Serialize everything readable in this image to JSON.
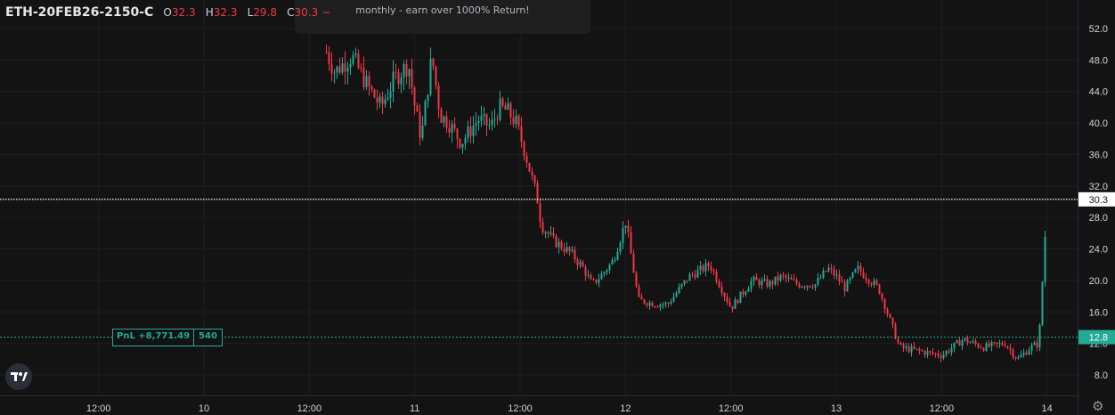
{
  "header": {
    "symbol": "ETH-20FEB26-2150-C",
    "open_label": "O",
    "open": "32.3",
    "high_label": "H",
    "high": "32.3",
    "low_label": "L",
    "low": "29.8",
    "close_label": "C",
    "close": "30.3",
    "change": "−"
  },
  "banner": {
    "text": "monthly - earn over 1000% Return!"
  },
  "pnl": {
    "label": "PnL +8,771.49",
    "qty": "540"
  },
  "y_ticks": [
    "52.0",
    "48.0",
    "44.0",
    "40.0",
    "36.0",
    "32.0",
    "28.0",
    "24.0",
    "20.0",
    "16.0",
    "12.0",
    "8.0"
  ],
  "x_ticks": [
    "12:00",
    "10",
    "12:00",
    "11",
    "12:00",
    "12",
    "12:00",
    "13",
    "12:00",
    "14"
  ],
  "last_price_tag": "30.3",
  "position_price_tag": "12.8",
  "icons": {
    "logo": "tradingview-logo-icon",
    "settings": "gear-icon"
  },
  "colors": {
    "up": "#22ab94",
    "down": "#f23645",
    "background": "#131313",
    "text": "#d1d4dc"
  },
  "chart_data": {
    "type": "candlestick",
    "y_range": [
      6.0,
      54.0
    ],
    "last_price": 30.3,
    "position_price": 12.8,
    "path_x_day": [
      10.58,
      10.62,
      10.7,
      10.78,
      10.84,
      10.9,
      10.97,
      11.0,
      11.03,
      11.08,
      11.12,
      11.16,
      11.22,
      11.3,
      11.36,
      11.4,
      11.44,
      11.48,
      11.52,
      11.58,
      11.6,
      11.66,
      11.74,
      11.8,
      11.84,
      11.88,
      11.94,
      12.0,
      12.06,
      12.14,
      12.2,
      12.3,
      12.4,
      12.5,
      12.6,
      12.68,
      12.74,
      12.82,
      12.9,
      12.96,
      13.0,
      13.04,
      13.1,
      13.2,
      13.3,
      13.4,
      13.5,
      13.6,
      13.7,
      13.8,
      13.86,
      13.92,
      13.96,
      14.0
    ],
    "path_y": [
      49.0,
      46.5,
      48.5,
      44.5,
      42.0,
      45.5,
      47.5,
      42.0,
      38.0,
      48.5,
      41.0,
      40.0,
      37.5,
      40.5,
      39.5,
      42.0,
      41.5,
      40.0,
      36.5,
      30.5,
      27.0,
      25.0,
      23.5,
      21.5,
      19.5,
      20.5,
      22.5,
      27.5,
      17.5,
      17.0,
      17.0,
      20.5,
      22.0,
      16.5,
      20.0,
      19.5,
      20.5,
      19.5,
      19.5,
      21.5,
      20.5,
      19.0,
      21.5,
      19.0,
      11.5,
      11.0,
      10.5,
      12.5,
      11.5,
      12.0,
      10.0,
      11.5,
      12.0,
      30.3
    ]
  }
}
